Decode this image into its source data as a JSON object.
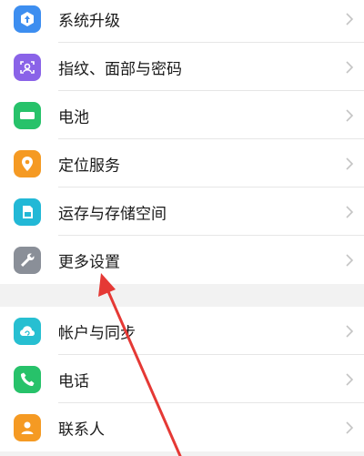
{
  "group1": {
    "items": [
      {
        "label": "系统升级",
        "icon": "system-update-icon",
        "color": "#3d8ef0"
      },
      {
        "label": "指纹、面部与密码",
        "icon": "fingerprint-face-icon",
        "color": "#8a63e8"
      },
      {
        "label": "电池",
        "icon": "battery-icon",
        "color": "#27c26a"
      },
      {
        "label": "定位服务",
        "icon": "location-icon",
        "color": "#f59a23"
      },
      {
        "label": "运存与存储空间",
        "icon": "storage-icon",
        "color": "#22b8d6"
      },
      {
        "label": "更多设置",
        "icon": "wrench-icon",
        "color": "#8a8f98"
      }
    ]
  },
  "group2": {
    "items": [
      {
        "label": "帐户与同步",
        "icon": "cloud-sync-icon",
        "color": "#27bfd1"
      },
      {
        "label": "电话",
        "icon": "phone-icon",
        "color": "#27c26a"
      },
      {
        "label": "联系人",
        "icon": "contacts-icon",
        "color": "#f59a23"
      }
    ]
  },
  "annotation": {
    "arrow_color": "#e53935"
  }
}
